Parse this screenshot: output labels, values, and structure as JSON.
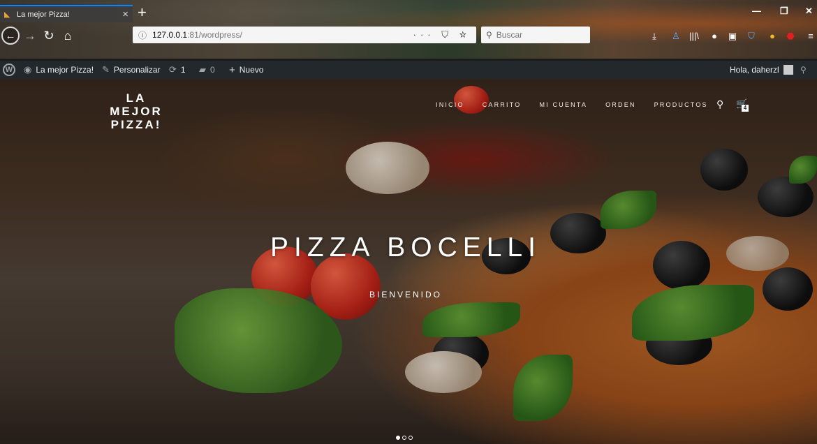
{
  "browser": {
    "tab_title": "La mejor Pizza!",
    "tab_close": "×",
    "new_tab": "+",
    "url_host": "127.0.0.1",
    "url_port": ":81",
    "url_path": "/wordpress/",
    "search_placeholder": "Buscar",
    "url_actions": "··· ⛉ ☆"
  },
  "adminbar": {
    "site_name": "La mejor Pizza!",
    "customize": "Personalizar",
    "updates_count": "1",
    "comments_count": "0",
    "new_label": "Nuevo",
    "greeting": "Hola, daherzl"
  },
  "site": {
    "brand": "LA MEJOR PIZZA!",
    "nav": [
      "INICIO",
      "CARRITO",
      "MI CUENTA",
      "ORDEN",
      "PRODUCTOS"
    ],
    "cart_count": "4"
  },
  "hero": {
    "title": "PIZZA BOCELLI",
    "subtitle": "BIENVENIDO",
    "slide_count": 3,
    "active_slide": 1
  },
  "colors": {
    "tab_accent": "#0a84ff",
    "admin_bar": "#23282d"
  }
}
